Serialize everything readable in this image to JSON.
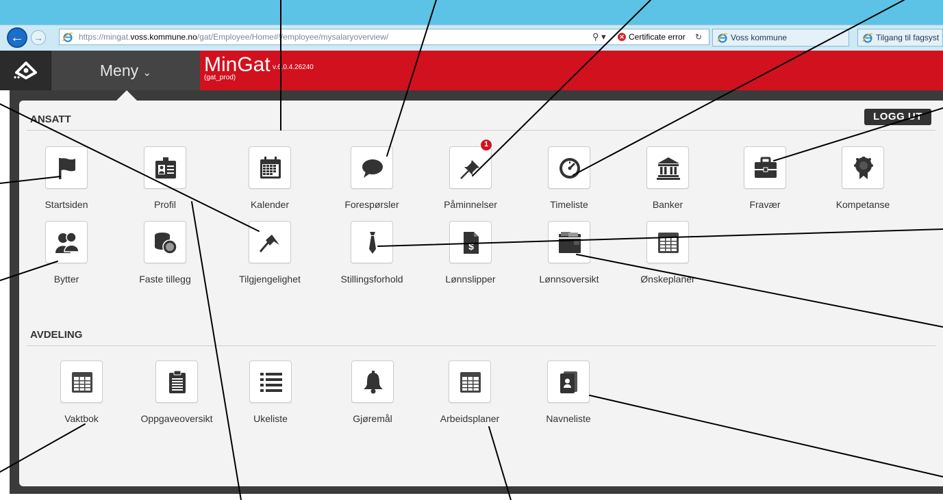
{
  "browser": {
    "url_prefix": "https://mingat.",
    "url_domain": "voss.kommune.no",
    "url_path": "/gat/Employee/Home#!/employee/mysalaryoverview/",
    "cert_error": "Certificate error",
    "tabs": [
      {
        "label": "Voss kommune"
      },
      {
        "label": "Tilgang til fagsyst"
      }
    ]
  },
  "header": {
    "menu_label": "Meny",
    "app_name": "MinGat",
    "version": "v.6.0.4.26240",
    "environment": "(gat_prod)"
  },
  "ansatt": {
    "title": "ANSATT",
    "logout": "LOGG UT",
    "badge": "1",
    "items": [
      {
        "label": "Startsiden",
        "icon": "flag-icon"
      },
      {
        "label": "Profil",
        "icon": "id-card-icon"
      },
      {
        "label": "Kalender",
        "icon": "calendar-icon"
      },
      {
        "label": "Forespørsler",
        "icon": "speech-bubble-icon"
      },
      {
        "label": "Påminnelser",
        "icon": "pushpin-icon"
      },
      {
        "label": "Timeliste",
        "icon": "clock-icon"
      },
      {
        "label": "Banker",
        "icon": "bank-icon"
      },
      {
        "label": "Fravær",
        "icon": "briefcase-icon"
      },
      {
        "label": "Kompetanse",
        "icon": "award-icon"
      },
      {
        "label": "Bytter",
        "icon": "users-icon"
      },
      {
        "label": "Faste tillegg",
        "icon": "coins-icon"
      },
      {
        "label": "Tilgjengelighet",
        "icon": "pennant-icon"
      },
      {
        "label": "Stillingsforhold",
        "icon": "tie-icon"
      },
      {
        "label": "Lønnslipper",
        "icon": "dollar-document-icon"
      },
      {
        "label": "Lønnsoversikt",
        "icon": "wallet-icon"
      },
      {
        "label": "Ønskeplaner",
        "icon": "table-icon"
      }
    ]
  },
  "avdeling": {
    "title": "AVDELING",
    "items": [
      {
        "label": "Vaktbok",
        "icon": "table-icon"
      },
      {
        "label": "Oppgaveoversikt",
        "icon": "clipboard-icon"
      },
      {
        "label": "Ukeliste",
        "icon": "list-icon"
      },
      {
        "label": "Gjøremål",
        "icon": "bell-icon"
      },
      {
        "label": "Arbeidsplaner",
        "icon": "table-icon"
      },
      {
        "label": "Navneliste",
        "icon": "contacts-icon"
      }
    ]
  }
}
